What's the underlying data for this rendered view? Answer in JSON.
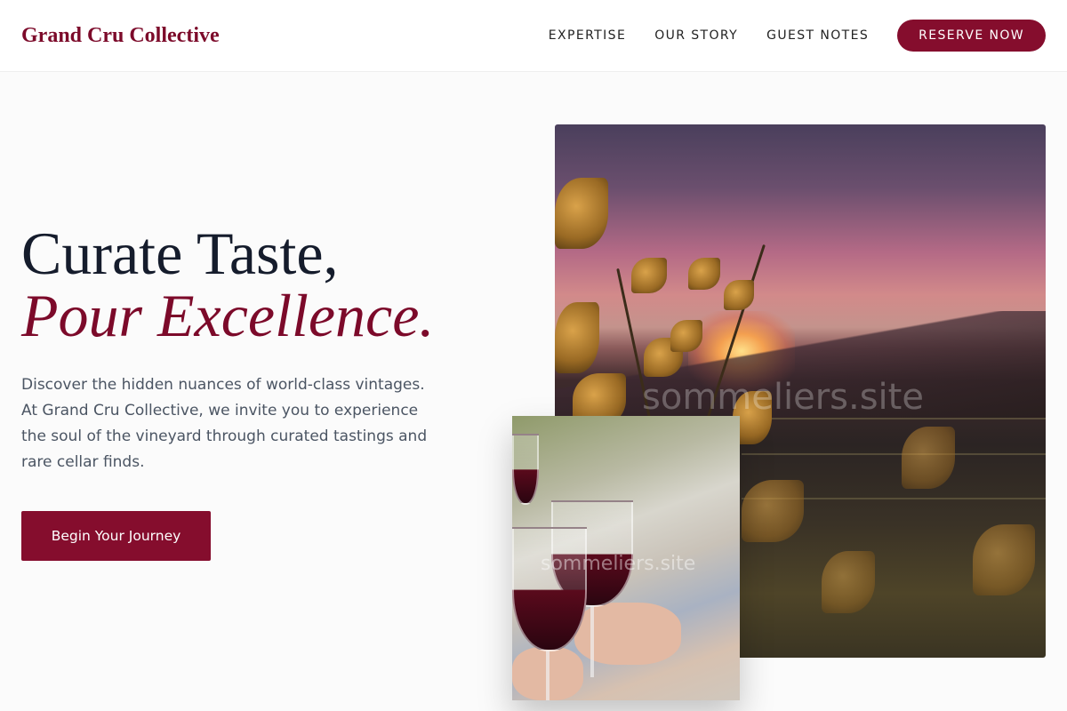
{
  "header": {
    "brand": "Grand Cru Collective",
    "nav": [
      {
        "label": "EXPERTISE"
      },
      {
        "label": "OUR STORY"
      },
      {
        "label": "GUEST NOTES"
      }
    ],
    "reserve_label": "RESERVE NOW"
  },
  "hero": {
    "headline_line1": "Curate Taste,",
    "headline_line2": "Pour Excellence.",
    "description": "Discover the hidden nuances of world-class vintages. At Grand Cru Collective, we invite you to experience the soul of the vineyard through curated tastings and rare cellar finds.",
    "cta_label": "Begin Your Journey"
  },
  "images": {
    "main_watermark": "sommeliers.site",
    "inset_watermark": "sommeliers.site"
  },
  "colors": {
    "accent": "#850d2d",
    "brand_text": "#7c0a2a",
    "headline": "#151c2c",
    "body_text": "#4b5563"
  }
}
